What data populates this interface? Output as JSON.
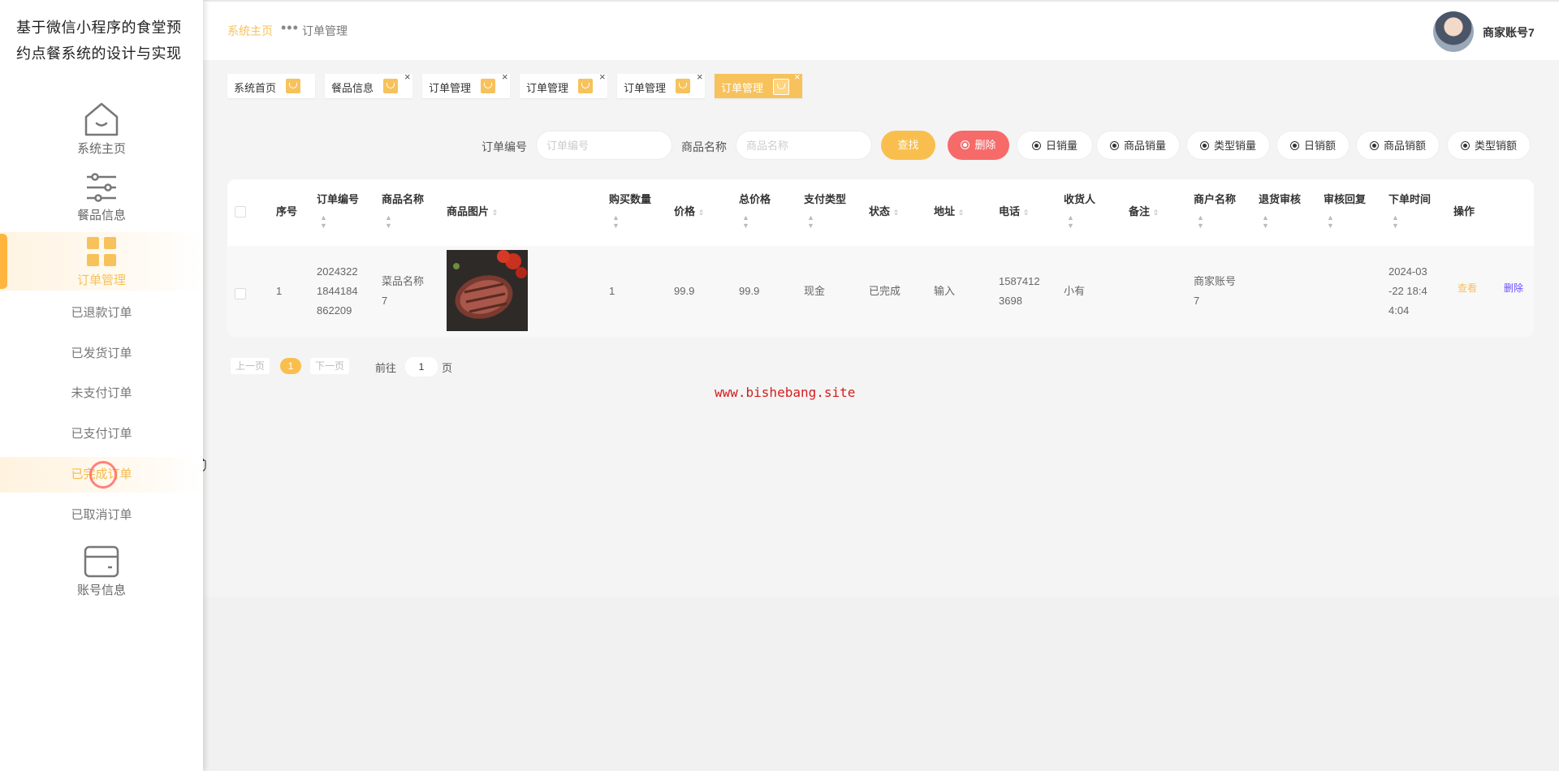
{
  "app": {
    "title": "基于微信小程序的食堂预约点餐系统的设计与实现"
  },
  "sidebar": {
    "home": {
      "label": "系统主页",
      "icon": "home-icon"
    },
    "meals": {
      "label": "餐品信息",
      "icon": "sliders-icon"
    },
    "orders": {
      "label": "订单管理",
      "icon": "grid-icon"
    },
    "sub_items": [
      "已退款订单",
      "已发货订单",
      "未支付订单",
      "已支付订单",
      "已完成订单",
      "已取消订单"
    ],
    "account": {
      "label": "账号信息",
      "icon": "wallet-icon"
    }
  },
  "header": {
    "breadcrumb_home": "系统主页",
    "breadcrumb_current": "订单管理",
    "user_name": "商家账号7"
  },
  "tabs": [
    {
      "label": "系统首页",
      "closable": false
    },
    {
      "label": "餐品信息",
      "closable": true
    },
    {
      "label": "订单管理",
      "closable": true
    },
    {
      "label": "订单管理",
      "closable": true
    },
    {
      "label": "订单管理",
      "closable": true
    },
    {
      "label": "订单管理",
      "closable": true
    }
  ],
  "filters": {
    "order_no_label": "订单编号",
    "order_no_placeholder": "订单编号",
    "product_label": "商品名称",
    "product_placeholder": "商品名称",
    "search_label": "查找",
    "delete_label": "删除",
    "stats": [
      "日销量",
      "商品销量",
      "类型销量",
      "日销额",
      "商品销额",
      "类型销额"
    ]
  },
  "table": {
    "headers": {
      "index": "序号",
      "order_no": "订单编号",
      "product": "商品名称",
      "image": "商品图片",
      "qty": "购买数量",
      "price": "价格",
      "total": "总价格",
      "pay_type": "支付类型",
      "status": "状态",
      "address": "地址",
      "phone": "电话",
      "receiver": "收货人",
      "remark": "备注",
      "merchant": "商户名称",
      "refund_review": "退货审核",
      "review_reply": "审核回复",
      "order_time": "下单时间",
      "actions": "操作"
    },
    "rows": [
      {
        "index": "1",
        "order_no_l1": "2024322",
        "order_no_l2": "1844184",
        "order_no_l3": "862209",
        "product_l1": "菜品名称",
        "product_l2": "7",
        "qty": "1",
        "price": "99.9",
        "total": "99.9",
        "pay_type": "现金",
        "status": "已完成",
        "address": "输入",
        "phone_l1": "1587412",
        "phone_l2": "3698",
        "receiver": "小有",
        "remark": "",
        "merchant_l1": "商家账号",
        "merchant_l2": "7",
        "refund_review": "",
        "review_reply": "",
        "time_l1": "2024-03",
        "time_l2": "-22 18:4",
        "time_l3": "4:04",
        "view_label": "查看",
        "delete_label": "删除"
      }
    ]
  },
  "pagination": {
    "prev": "上一页",
    "current": "1",
    "next": "下一页",
    "goto": "前往",
    "goto_value": "1",
    "page_unit": "页"
  },
  "watermark": "www.bishebang.site",
  "colors": {
    "accent": "#f7c25c",
    "danger": "#f76a6a",
    "link_delete": "#6b4dff"
  }
}
